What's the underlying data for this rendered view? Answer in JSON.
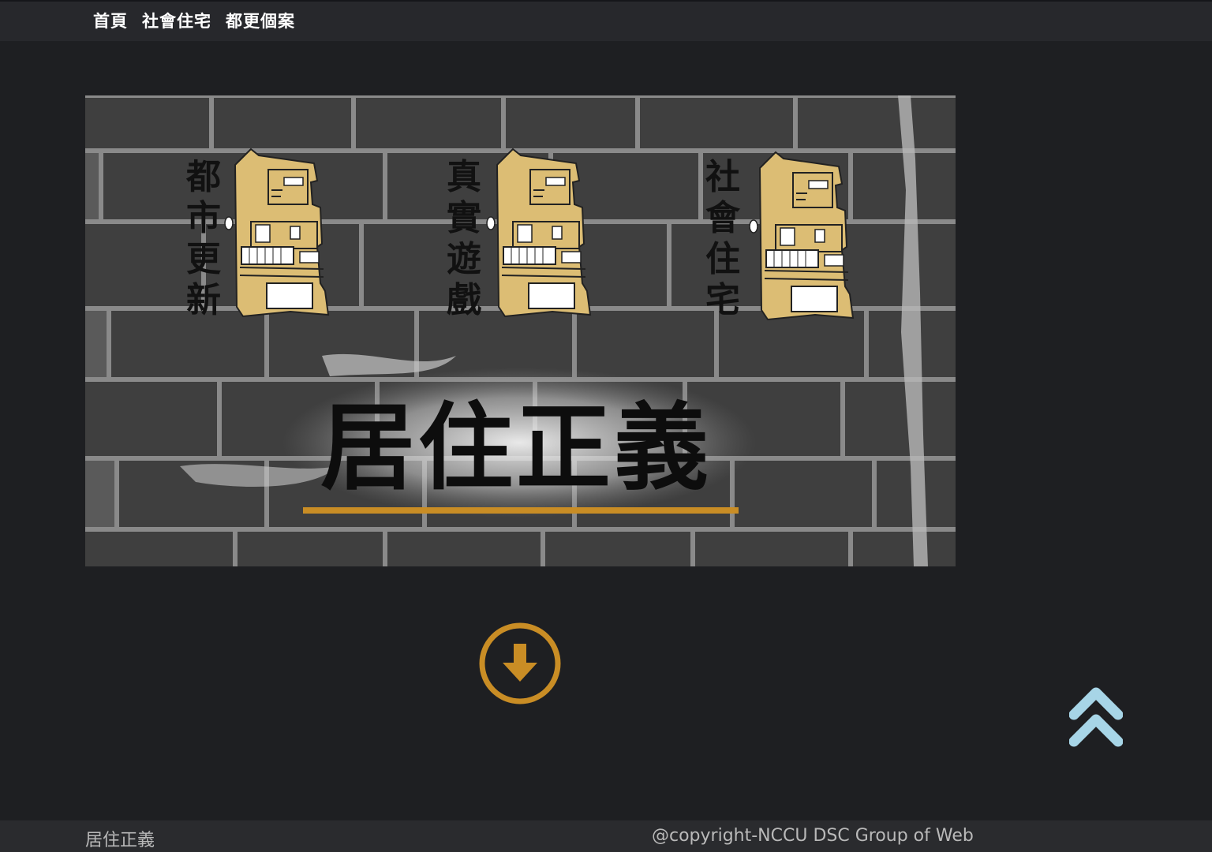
{
  "nav": {
    "items": [
      {
        "label": "首頁"
      },
      {
        "label": "社會住宅"
      },
      {
        "label": "都更個案"
      }
    ]
  },
  "banner": {
    "title": "居住正義",
    "sections": [
      {
        "label_chars": [
          "都",
          "市",
          "更",
          "新"
        ]
      },
      {
        "label_chars": [
          "真",
          "實",
          "遊",
          "戲"
        ]
      },
      {
        "label_chars": [
          "社",
          "會",
          "住",
          "宅"
        ]
      }
    ],
    "underline_color": "#c98d25",
    "building_color": "#dcbd74"
  },
  "icons": {
    "download": "arrow-circle-down-icon",
    "back_to_top": "double-chevron-up-icon"
  },
  "colors": {
    "background": "#1e1f22",
    "nav_background": "#27282c",
    "accent": "#c98d25",
    "to_top": "#a7d5e7"
  },
  "footer": {
    "left_text": "居住正義",
    "right_text": "@copyright-NCCU DSC Group of Web"
  }
}
